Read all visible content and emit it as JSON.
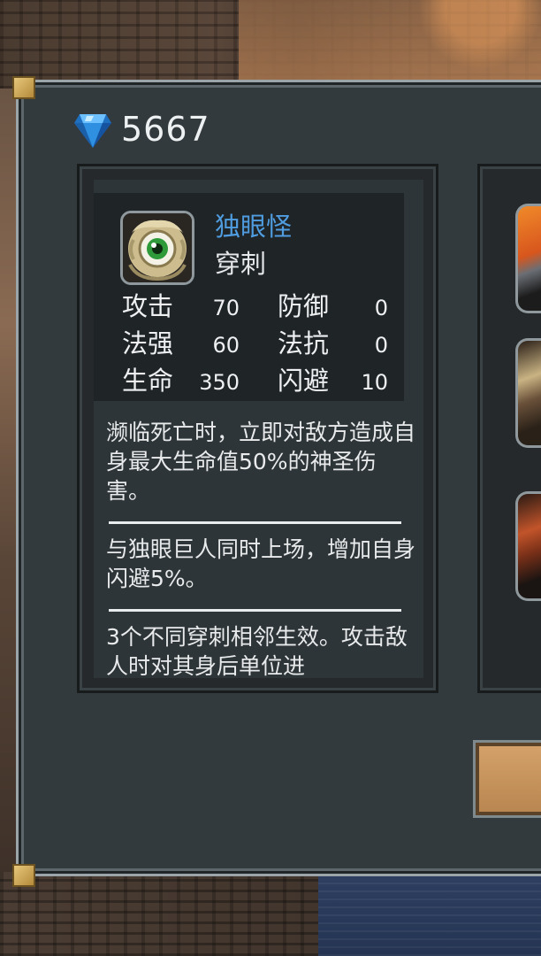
{
  "currency": {
    "icon": "diamond-icon",
    "amount": "5667",
    "icon_color": "#2f8fe0"
  },
  "unit": {
    "portrait_icon": "one-eyed-monster-portrait",
    "name": "独眼怪",
    "trait": "穿刺",
    "name_color": "#4f9de0",
    "stats": [
      {
        "label": "攻击",
        "value": "70"
      },
      {
        "label": "防御",
        "value": "0"
      },
      {
        "label": "法强",
        "value": "60"
      },
      {
        "label": "法抗",
        "value": "0"
      },
      {
        "label": "生命",
        "value": "350"
      },
      {
        "label": "闪避",
        "value": "10"
      }
    ]
  },
  "descriptions": [
    "濒临死亡时，立即对敌方造成自身最大生命值50%的神圣伤害。",
    "与独眼巨人同时上场，增加自身闪避5%。",
    "3个不同穿刺相邻生效。攻击敌人时对其身后单位进"
  ],
  "side_slots": [
    "unit-slot",
    "unit-slot",
    "unit-slot"
  ]
}
